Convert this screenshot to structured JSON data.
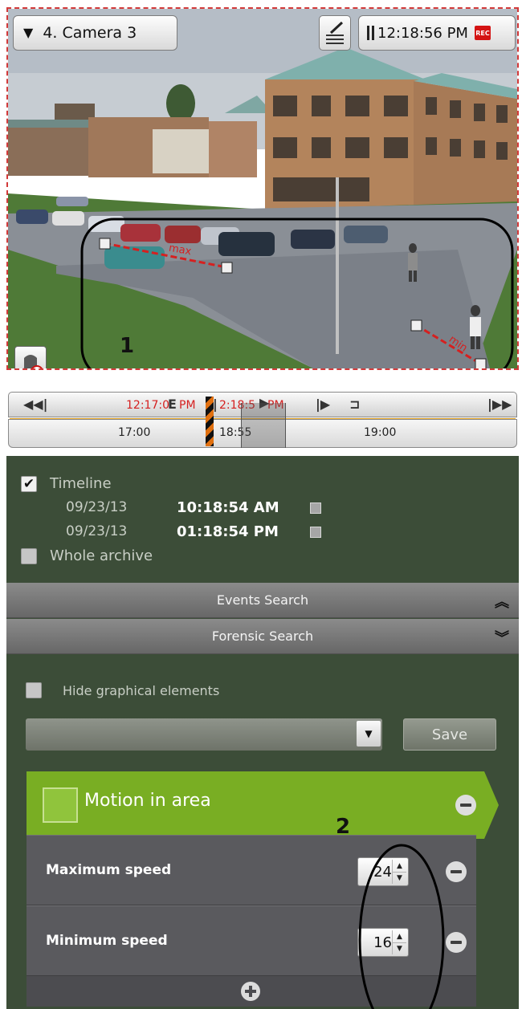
{
  "camera": {
    "name": "4. Camera 3"
  },
  "clock": {
    "time": "12:18:56 PM",
    "rec_badge": "REC"
  },
  "overlay": {
    "max_label": "max",
    "min_label": "min",
    "marker_1": "1",
    "marker_2": "2"
  },
  "timeline": {
    "current_left": "12:17:0",
    "current_mid": "PM",
    "current_right": "2:18:5",
    "current_right_pm": "PM",
    "ticks": [
      "17:00",
      "18:55",
      "19:00"
    ]
  },
  "filter": {
    "timeline_label": "Timeline",
    "timeline_checked": true,
    "from_date": "09/23/13",
    "from_time": "10:18:54 AM",
    "to_date": "09/23/13",
    "to_time": "01:18:54 PM",
    "whole_archive_label": "Whole archive",
    "whole_archive_checked": false
  },
  "sections": {
    "events_search": "Events Search",
    "forensic_search": "Forensic Search"
  },
  "forensic": {
    "hide_graphical_label": "Hide graphical elements",
    "preset_value": "",
    "save_label": "Save",
    "condition_title": "Motion in area",
    "params": [
      {
        "label": "Maximum speed",
        "value": "24"
      },
      {
        "label": "Minimum speed",
        "value": "16"
      }
    ]
  },
  "colors": {
    "panel_bg": "#3c4d38",
    "condition_green": "#79ae23",
    "overlay_red": "#d52020"
  }
}
